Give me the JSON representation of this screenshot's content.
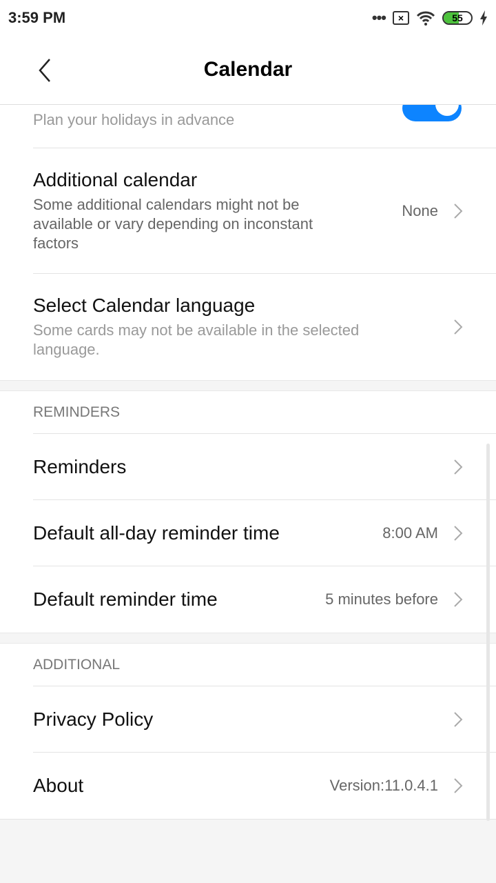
{
  "status_bar": {
    "time": "3:59 PM",
    "battery": "55",
    "icons": [
      "more-dots-icon",
      "no-sim-icon",
      "wifi-icon",
      "battery-icon",
      "charging-icon"
    ]
  },
  "header": {
    "title": "Calendar",
    "back_icon": "chevron-left-icon"
  },
  "colors": {
    "accent": "#0d84ff",
    "battery": "#4cc23c"
  },
  "top_item": {
    "subtitle": "Plan your holidays in advance",
    "toggle_on": true
  },
  "items": [
    {
      "title": "Additional calendar",
      "subtitle": "Some additional calendars might not be available or vary depending on inconstant factors",
      "value": "None"
    },
    {
      "title": "Select Calendar language",
      "subtitle": "Some cards may not be available in the selected language.",
      "value": ""
    }
  ],
  "reminders": {
    "header": "REMINDERS",
    "items": [
      {
        "title": "Reminders",
        "value": ""
      },
      {
        "title": "Default all-day reminder time",
        "value": "8:00 AM"
      },
      {
        "title": "Default reminder time",
        "value": "5 minutes before"
      }
    ]
  },
  "additional": {
    "header": "ADDITIONAL",
    "items": [
      {
        "title": "Privacy Policy",
        "value": ""
      },
      {
        "title": "About",
        "value": "Version:11.0.4.1"
      }
    ]
  }
}
